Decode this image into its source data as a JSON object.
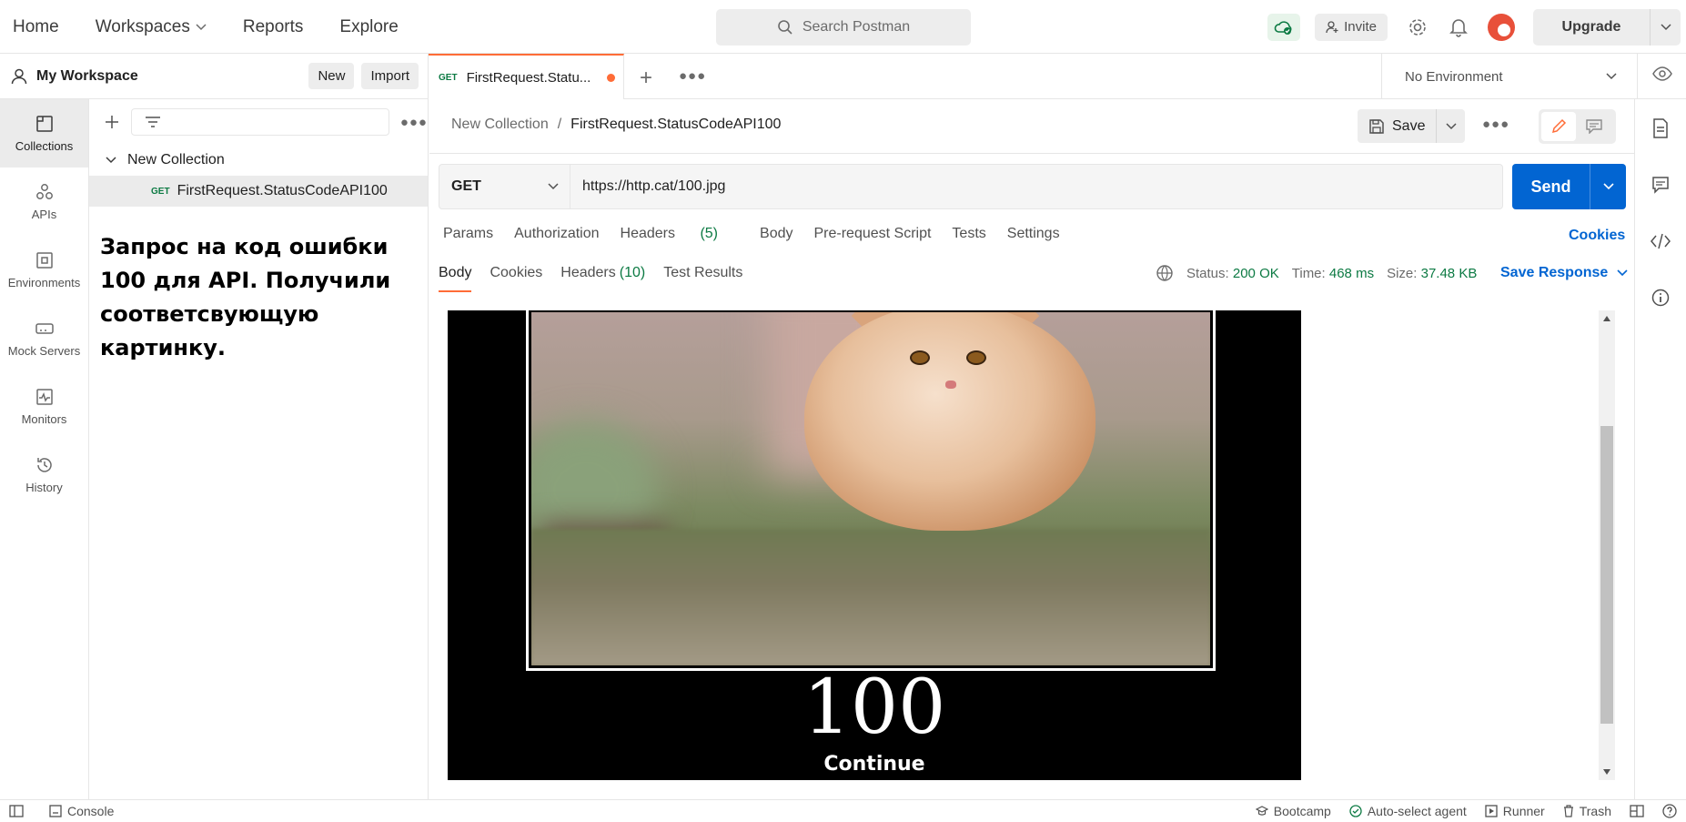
{
  "topnav": {
    "home": "Home",
    "workspaces": "Workspaces",
    "reports": "Reports",
    "explore": "Explore",
    "search_placeholder": "Search Postman",
    "invite": "Invite",
    "upgrade": "Upgrade"
  },
  "workspace": {
    "name": "My Workspace",
    "new_label": "New",
    "import_label": "Import"
  },
  "rail": {
    "items": [
      {
        "label": "Collections",
        "icon": "collections-icon"
      },
      {
        "label": "APIs",
        "icon": "apis-icon"
      },
      {
        "label": "Environments",
        "icon": "environments-icon"
      },
      {
        "label": "Mock Servers",
        "icon": "mock-servers-icon"
      },
      {
        "label": "Monitors",
        "icon": "monitors-icon"
      },
      {
        "label": "History",
        "icon": "history-icon"
      }
    ]
  },
  "sidebar": {
    "collection_name": "New Collection",
    "request_method": "GET",
    "request_name": "FirstRequest.StatusCodeAPI100",
    "note": "Запрос на код ошибки 100 для API. Получили соответсвующую картинку."
  },
  "tab": {
    "method": "GET",
    "title": "FirstRequest.Statu..."
  },
  "environment": {
    "selected": "No Environment"
  },
  "request": {
    "breadcrumb_collection": "New Collection",
    "breadcrumb_sep": "/",
    "breadcrumb_request": "FirstRequest.StatusCodeAPI100",
    "save_label": "Save",
    "method": "GET",
    "url": "https://http.cat/100.jpg",
    "send_label": "Send",
    "tabs": {
      "params": "Params",
      "authorization": "Authorization",
      "headers": "Headers",
      "headers_count": "(5)",
      "body": "Body",
      "prerequest": "Pre-request Script",
      "tests": "Tests",
      "settings": "Settings"
    },
    "cookies_link": "Cookies"
  },
  "response": {
    "tabs": {
      "body": "Body",
      "cookies": "Cookies",
      "headers": "Headers",
      "headers_count": "(10)",
      "test_results": "Test Results"
    },
    "status_label": "Status:",
    "status_value": "200 OK",
    "time_label": "Time:",
    "time_value": "468 ms",
    "size_label": "Size:",
    "size_value": "37.48 KB",
    "save_response": "Save Response",
    "image_number": "100",
    "image_caption": "Continue"
  },
  "statusbar": {
    "console": "Console",
    "bootcamp": "Bootcamp",
    "auto_select_agent": "Auto-select agent",
    "runner": "Runner",
    "trash": "Trash"
  },
  "colors": {
    "accent_orange": "#ff6c37",
    "send_blue": "#0265d2",
    "success_green": "#0c7a43"
  }
}
